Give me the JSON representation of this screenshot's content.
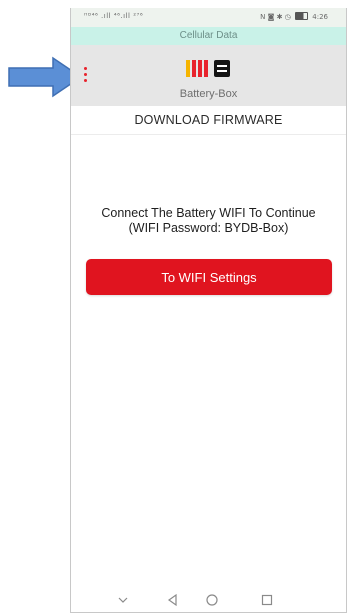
{
  "status_bar": {
    "left_text": "ᴴᴰ⁴⁶ .ıll ⁴⁶.ıll ²⁷⁶",
    "right_text": "N ◙ ✱ ◷",
    "time": "4:26"
  },
  "banner": {
    "text": "Cellular Data",
    "background": "#c9f2e8"
  },
  "app": {
    "name": "Battery-Box",
    "logo_colors": [
      "#f5b400",
      "#e8232d",
      "#e8232d",
      "#e8232d"
    ]
  },
  "page": {
    "heading": "DOWNLOAD FIRMWARE",
    "message_line1": "Connect The Battery WIFI To Continue",
    "message_line2": "(WIFI Password: BYDB-Box)",
    "button_label": "To WIFI Settings",
    "accent": "#e0141f"
  },
  "nav": {
    "icons": [
      "chevron-down-icon",
      "back-icon",
      "home-icon",
      "recents-icon"
    ]
  },
  "annotation": {
    "arrow_color": "#5b8fd6"
  }
}
